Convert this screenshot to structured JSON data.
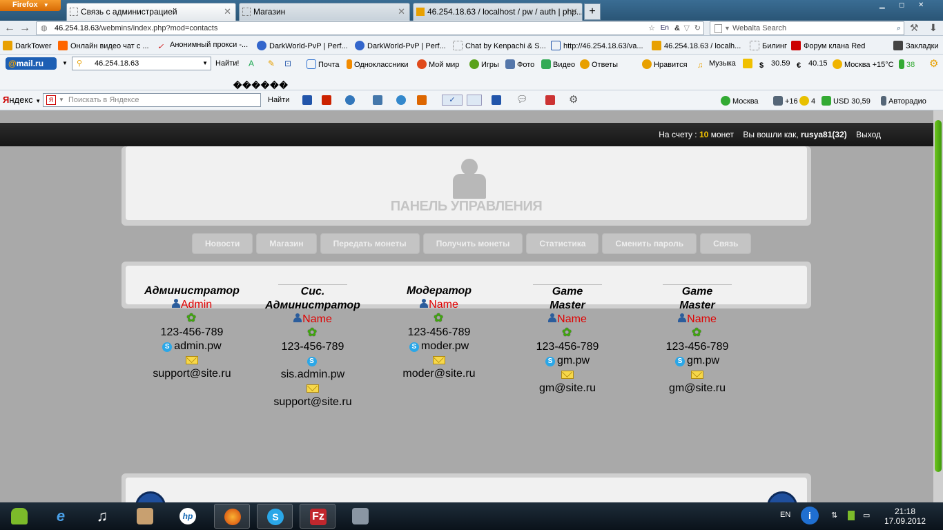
{
  "browser": {
    "menu_label": "Firefox",
    "tabs": [
      {
        "label": "Связь с администрацией"
      },
      {
        "label": "Магазин"
      },
      {
        "label": "46.254.18.63 / localhost / pw / auth | php..."
      }
    ],
    "url_host": "46.254.18.63",
    "url_path": "/webmins/index.php?mod=contacts",
    "search_placeholder": "Webalta Search",
    "bookmarks": [
      {
        "label": "DarkTower",
        "color": "#e8a000"
      },
      {
        "label": "Онлайн видео чат с ...",
        "color": "#ff6600"
      },
      {
        "label": "Анонимный прокси -...",
        "color": "#cc0000"
      },
      {
        "label": "DarkWorld-PvP | Perf...",
        "color": "#3366cc"
      },
      {
        "label": "DarkWorld-PvP | Perf...",
        "color": "#3366cc"
      },
      {
        "label": "Chat by Kenpachi & S...",
        "color": "#ffffff"
      },
      {
        "label": "http://46.254.18.63/va...",
        "color": "#2255aa"
      },
      {
        "label": "46.254.18.63 / localh...",
        "color": "#e8a000"
      },
      {
        "label": "Билинг",
        "color": "#ffffff"
      },
      {
        "label": "Форум клана Red",
        "color": "#cc0000"
      },
      {
        "label": "Закладки",
        "color": "#444444"
      }
    ]
  },
  "mailbar": {
    "logo": "mail.ru",
    "search_value": "46.254.18.63",
    "find_label": "Найти!",
    "items": [
      {
        "label": "Почта",
        "color": "#2b6fcf"
      },
      {
        "label": "Одноклассники",
        "color": "#f28b00"
      },
      {
        "label": "Мой мир",
        "color": "#e04a1b"
      },
      {
        "label": "Игры",
        "color": "#5aa21c"
      },
      {
        "label": "Фото",
        "color": "#5577aa"
      },
      {
        "label": "Видео",
        "color": "#33aa55"
      },
      {
        "label": "Ответы",
        "color": "#e8a000"
      },
      {
        "label": "Нравится",
        "color": "#e8a000"
      },
      {
        "label": "Музыка",
        "color": "#e8a000"
      },
      {
        "label": "30.59",
        "color": "#cc0000"
      },
      {
        "label": "40.15",
        "color": "#cc0000"
      },
      {
        "label": "Москва +15°C",
        "color": "#f0b400"
      },
      {
        "label": "38",
        "color": "#33aa33"
      }
    ],
    "garbled": "������"
  },
  "yandexbar": {
    "logo_first": "Я",
    "logo_rest": "ндекс",
    "search_placeholder": "Поискать в Яндексе",
    "find_label": "Найти",
    "right_items": [
      {
        "label": "Москва"
      },
      {
        "label": "+16"
      },
      {
        "label": "4"
      },
      {
        "label": "USD 30,59"
      },
      {
        "label": "Авторадио"
      }
    ]
  },
  "page": {
    "balance_prefix": "На счету :",
    "balance_amount": "10",
    "balance_suffix": "монет",
    "logged_in_prefix": "Вы вошли как,",
    "username": "rusya81(32)",
    "logout_label": "Выход",
    "panel_title": "ПАНЕЛЬ УПРАВЛЕНИЯ",
    "menu": [
      {
        "label": "Новости"
      },
      {
        "label": "Магазин"
      },
      {
        "label": "Передать монеты"
      },
      {
        "label": "Получить монеты"
      },
      {
        "label": "Статистика"
      },
      {
        "label": "Сменить пароль"
      },
      {
        "label": "Связь"
      }
    ],
    "contacts": [
      {
        "role": "Администратор",
        "name": "Admin",
        "icq": "123-456-789",
        "skype": "admin.pw",
        "email": "support@site.ru"
      },
      {
        "role": "Сис. Администратор",
        "name": "Name",
        "icq": "123-456-789",
        "skype": "sis.admin.pw",
        "email": "support@site.ru"
      },
      {
        "role": "Модератор",
        "name": "Name",
        "icq": "123-456-789",
        "skype": "moder.pw",
        "email": "moder@site.ru"
      },
      {
        "role": "Game Master",
        "name": "Name",
        "icq": "123-456-789",
        "skype": "gm.pw",
        "email": "gm@site.ru"
      },
      {
        "role": "Game Master",
        "name": "Name",
        "icq": "123-456-789",
        "skype": "gm.pw",
        "email": "gm@site.ru"
      }
    ]
  },
  "taskbar": {
    "language": "EN",
    "time": "21:18",
    "date": "17.09.2012"
  }
}
